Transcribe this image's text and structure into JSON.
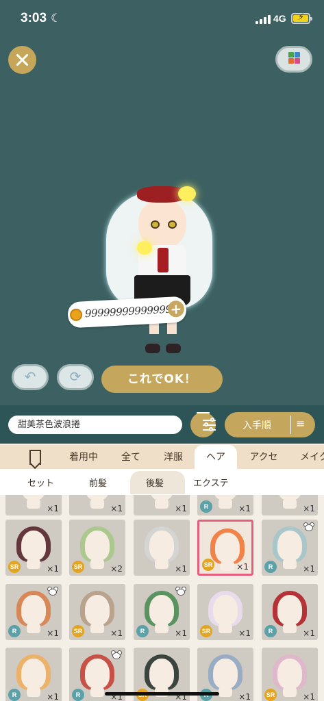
{
  "status_bar": {
    "time": "3:03",
    "network": "4G"
  },
  "coin_bubble": {
    "amount": "99999999999999"
  },
  "actions": {
    "ok_label": "これでOK！"
  },
  "search": {
    "value": "甜美茶色波浪捲"
  },
  "sort": {
    "label": "入手順"
  },
  "tabs": [
    {
      "label": "着用中"
    },
    {
      "label": "全て"
    },
    {
      "label": "洋服"
    },
    {
      "label": "ヘア",
      "active": true
    },
    {
      "label": "アクセ"
    },
    {
      "label": "メイク"
    }
  ],
  "subtabs": [
    {
      "label": "セット"
    },
    {
      "label": "前髪"
    },
    {
      "label": "後髪",
      "active": true
    },
    {
      "label": "エクステ"
    }
  ],
  "items": [
    {
      "rarity": "",
      "count": "×1"
    },
    {
      "rarity": "",
      "count": "×1"
    },
    {
      "rarity": "",
      "count": "×1"
    },
    {
      "rarity": "R",
      "count": "×1"
    },
    {
      "rarity": "",
      "count": "×1"
    },
    {
      "rarity": "SR",
      "count": "×1",
      "hair": "#5a2a32"
    },
    {
      "rarity": "SR",
      "count": "×2",
      "hair": "#a8c98a"
    },
    {
      "rarity": "",
      "count": "×1",
      "hair": "#d5d5d5"
    },
    {
      "rarity": "SR",
      "count": "×1",
      "hair": "#f17a3c",
      "selected": true
    },
    {
      "rarity": "R",
      "count": "×1",
      "hair": "#a6c7cb",
      "bear": true
    },
    {
      "rarity": "R",
      "count": "×1",
      "hair": "#d9824e",
      "bear": true
    },
    {
      "rarity": "SR",
      "count": "×1",
      "hair": "#b79f88"
    },
    {
      "rarity": "R",
      "count": "×1",
      "hair": "#4f8e58",
      "bear": true
    },
    {
      "rarity": "SR",
      "count": "×1",
      "hair": "#eadcef"
    },
    {
      "rarity": "R",
      "count": "×1",
      "hair": "#b3262a"
    },
    {
      "rarity": "R",
      "count": "×1",
      "hair": "#f0b062"
    },
    {
      "rarity": "R",
      "count": "×1",
      "hair": "#c8463d",
      "bear": true
    },
    {
      "rarity": "SR",
      "count": "×1",
      "hair": "#2f3a33"
    },
    {
      "rarity": "R",
      "count": "×1",
      "hair": "#94a9c4"
    },
    {
      "rarity": "SR",
      "count": "×1",
      "hair": "#e1b7cc"
    }
  ],
  "colors": {
    "stage": "#3d6162",
    "accent_gold": "#c4a65d",
    "selected_border": "#e35f7d"
  },
  "icons": {
    "close": "x-icon",
    "palette": "color-palette-icon",
    "undo": "undo-icon",
    "reset": "refresh-icon",
    "filter": "sliders-icon",
    "sort": "sort-order-icon",
    "bookmark": "bookmark-icon"
  }
}
